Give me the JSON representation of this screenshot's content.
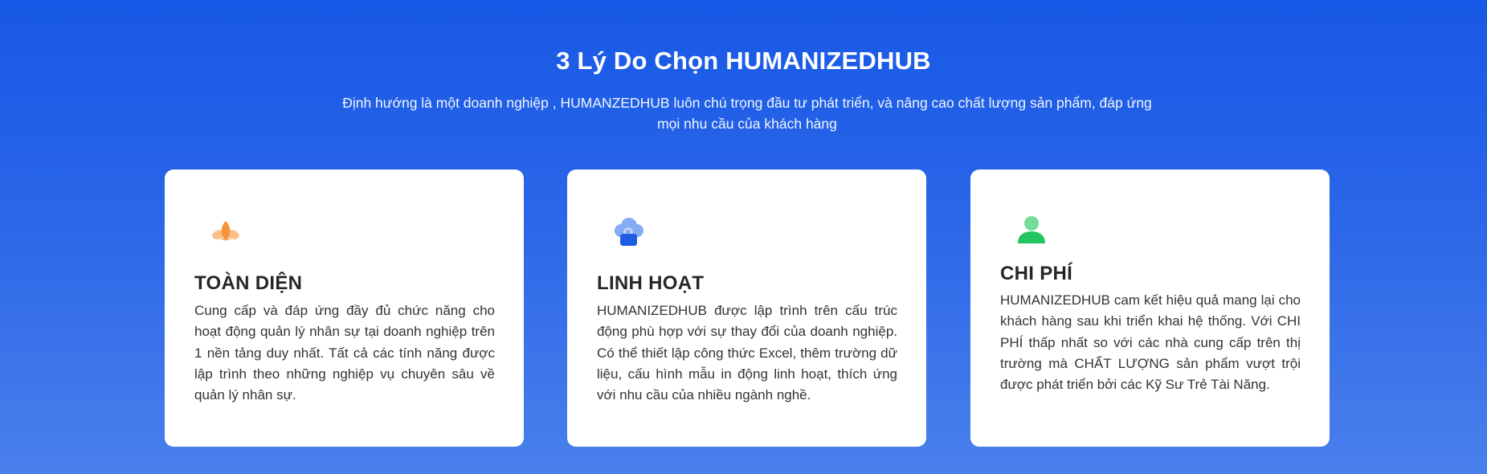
{
  "section": {
    "title": "3 Lý Do Chọn HUMANIZEDHUB",
    "subtitle": "Định hướng là một doanh nghiệp , HUMANZEDHUB luôn chú trọng đầu tư phát triển, và nâng cao chất lượng sản phẩm, đáp ứng mọi nhu cầu của khách hàng"
  },
  "cards": [
    {
      "icon": "lotus-icon",
      "title": "TOÀN DIỆN",
      "description": "Cung cấp và đáp ứng đầy đủ chức năng cho hoạt động quản lý nhân sự tại doanh nghiệp trên 1 nền tảng duy nhất. Tất cả các tính năng được lập trình theo những nghiệp vụ chuyên sâu về quản lý nhân sự."
    },
    {
      "icon": "cloud-lock-icon",
      "title": "LINH HOẠT",
      "description": "HUMANIZEDHUB được lập trình trên cấu trúc động phù hợp với sự thay đổi của doanh nghiệp. Có thể thiết lập công thức Excel, thêm trường dữ liệu, cấu hình mẫu in động linh hoạt, thích ứng với nhu cầu của nhiều ngành nghề."
    },
    {
      "icon": "user-icon",
      "title": "CHI PHÍ",
      "description": "HUMANIZEDHUB cam kết hiệu quả mang lại cho khách hàng sau khi triển khai hệ thống. Với CHI PHÍ thấp nhất so với các nhà cung cấp trên thị trường mà CHẤT LƯỢNG sản phẩm vượt trội được phát triển bởi các Kỹ Sư Trẻ Tài Năng."
    }
  ],
  "colors": {
    "background_top": "#1758e6",
    "background_bottom": "#4a80ec",
    "lotus_icon": "#f7a24c",
    "cloud_icon": "#7aa3f2",
    "lock_icon": "#1f5de3",
    "user_icon": "#22c55e"
  }
}
